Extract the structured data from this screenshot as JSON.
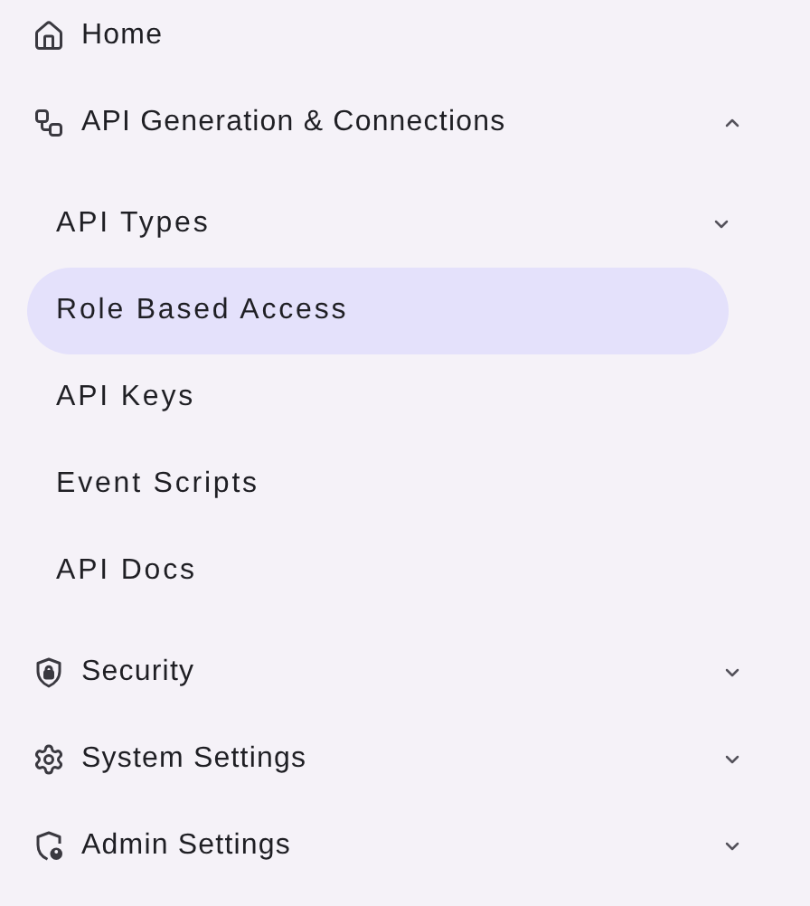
{
  "nav": [
    {
      "kind": "link",
      "label": "Home"
    },
    {
      "kind": "group",
      "label": "API Generation & Connections",
      "expanded": true,
      "children": [
        {
          "kind": "group",
          "label": "API Types",
          "expanded": false,
          "selected": false
        },
        {
          "kind": "link",
          "label": "Role Based Access",
          "selected": true
        },
        {
          "kind": "link",
          "label": "API Keys",
          "selected": false
        },
        {
          "kind": "link",
          "label": "Event Scripts",
          "selected": false
        },
        {
          "kind": "link",
          "label": "API Docs",
          "selected": false
        }
      ]
    },
    {
      "kind": "group",
      "label": "Security",
      "expanded": false
    },
    {
      "kind": "group",
      "label": "System Settings",
      "expanded": false
    },
    {
      "kind": "group",
      "label": "Admin Settings",
      "expanded": false
    }
  ]
}
